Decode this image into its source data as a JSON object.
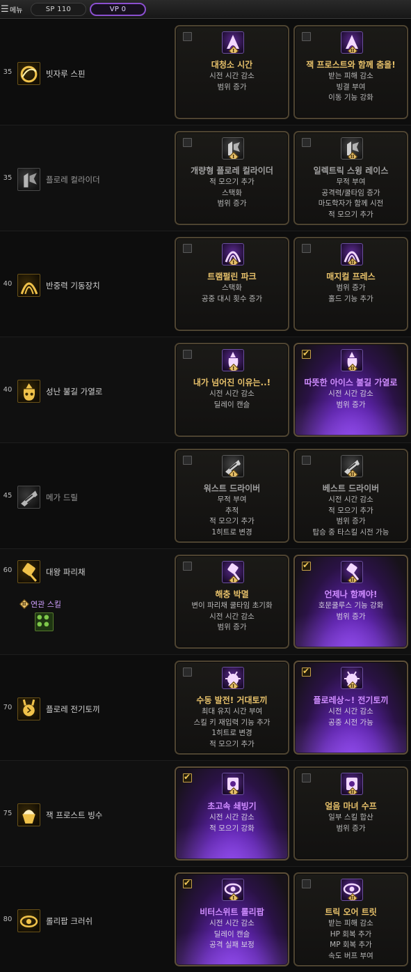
{
  "topbar": {
    "menu_icon": "hamburger-icon",
    "menu_label": "메뉴",
    "sp": "SP 110",
    "vp": "VP 0"
  },
  "rows": [
    {
      "level": "35",
      "name": "빗자루 스핀",
      "icon": "broom-spin-icon",
      "grey": false,
      "options": [
        {
          "checked": false,
          "roman": "I",
          "title": "대청소 시간",
          "title_color": "gold",
          "icon": "witch-hat-icon",
          "lines": [
            "시전 시간 감소",
            "범위 증가"
          ]
        },
        {
          "checked": false,
          "roman": "II",
          "title": "잭 프로스트와 함께 춤을!",
          "title_color": "gold",
          "icon": "witch-hat-icon",
          "lines": [
            "받는 피해 감소",
            "빙결 부여",
            "이동 기능 강화"
          ]
        }
      ]
    },
    {
      "level": "35",
      "name": "플로레 컬라이더",
      "icon": "flore-collider-icon",
      "grey": true,
      "options": [
        {
          "checked": false,
          "roman": "I",
          "title": "개량형 플로레 컬라이더",
          "title_color": "grey",
          "icon": "collider-icon",
          "lines": [
            "적 모으기 추가",
            "스택화",
            "범위 증가"
          ]
        },
        {
          "checked": false,
          "roman": "II",
          "title": "일렉트릭 스윙 레이스",
          "title_color": "grey",
          "icon": "collider-icon",
          "lines": [
            "무적 부여",
            "공격력/쿨타임 증가",
            "마도학자가 함께 시전",
            "적 모으기 추가"
          ]
        }
      ]
    },
    {
      "level": "40",
      "name": "반중력 기동장치",
      "icon": "antigravity-icon",
      "grey": false,
      "options": [
        {
          "checked": false,
          "roman": "I",
          "title": "트램펄린 파크",
          "title_color": "gold",
          "icon": "arch-icon",
          "lines": [
            "스택화",
            "공중 대시 횟수 증가"
          ]
        },
        {
          "checked": false,
          "roman": "II",
          "title": "매지컬 프레스",
          "title_color": "gold",
          "icon": "arch-icon",
          "lines": [
            "범위 증가",
            "홀드 기능 추가"
          ]
        }
      ]
    },
    {
      "level": "40",
      "name": "성난 불길 가열로",
      "icon": "furnace-bag-icon",
      "grey": false,
      "options": [
        {
          "checked": false,
          "roman": "I",
          "title": "내가 넘어진 이유는..!",
          "title_color": "gold",
          "icon": "flame-bag-icon",
          "lines": [
            "시전 시간 감소",
            "딜레이 캔슬"
          ]
        },
        {
          "checked": true,
          "roman": "II",
          "title": "따뜻한 아이스 불길 가열로",
          "title_color": "purple",
          "icon": "flame-bag-icon",
          "lines": [
            "시전 시간 감소",
            "범위 증가"
          ]
        }
      ]
    },
    {
      "level": "45",
      "name": "메가 드릴",
      "icon": "mega-drill-icon",
      "grey": true,
      "options": [
        {
          "checked": false,
          "roman": "I",
          "title": "워스트 드라이버",
          "title_color": "grey",
          "icon": "drill-icon",
          "lines": [
            "무적 부여",
            "추적",
            "적 모으기 추가",
            "1히트로 변경"
          ]
        },
        {
          "checked": false,
          "roman": "II",
          "title": "베스트 드라이버",
          "title_color": "grey",
          "icon": "drill-icon",
          "lines": [
            "시전 시간 감소",
            "적 모으기 추가",
            "범위 증가",
            "탑승 중 타스킬 시전 가능"
          ]
        }
      ]
    },
    {
      "level": "60",
      "name": "대왕 파리채",
      "icon": "fly-swatter-icon",
      "grey": false,
      "related": {
        "roman": "II",
        "label": "연관 스킬",
        "icon": "related-skill-icon"
      },
      "options": [
        {
          "checked": false,
          "roman": "I",
          "title": "해충 박멸",
          "title_color": "gold",
          "icon": "swatter-icon",
          "lines": [
            "변이 파리채 쿨타임 초기화",
            "시전 시간 감소",
            "범위 증가"
          ]
        },
        {
          "checked": true,
          "roman": "II",
          "title": "언제나 함께야!",
          "title_color": "purple",
          "icon": "swatter-icon",
          "lines": [
            "호문쿨루스 기능 강화",
            "범위 증가"
          ]
        }
      ]
    },
    {
      "level": "70",
      "name": "플로레 전기토끼",
      "icon": "electric-rabbit-icon",
      "grey": false,
      "options": [
        {
          "checked": false,
          "roman": "I",
          "title": "수동 발전! 거대토끼",
          "title_color": "gold",
          "icon": "rabbit-icon",
          "lines": [
            "최대 유지 시간 부여",
            "스킬 키 재입력 기능 추가",
            "1히트로 변경",
            "적 모으기 추가"
          ]
        },
        {
          "checked": true,
          "roman": "II",
          "title": "플로레상~! 전기토끼",
          "title_color": "purple",
          "icon": "rabbit-icon",
          "lines": [
            "시전 시간 감소",
            "공중 시전 가능"
          ]
        }
      ]
    },
    {
      "level": "75",
      "name": "잭 프로스트 빙수",
      "icon": "shaved-ice-icon",
      "grey": false,
      "options": [
        {
          "checked": true,
          "roman": "I",
          "title": "초고속 쇄빙기",
          "title_color": "purple",
          "icon": "ice-machine-icon",
          "lines": [
            "시전 시간 감소",
            "적 모으기 강화"
          ]
        },
        {
          "checked": false,
          "roman": "II",
          "title": "얼음 마녀 수프",
          "title_color": "gold",
          "icon": "ice-machine-icon",
          "lines": [
            "일부 스킬 합산",
            "범위 증가"
          ]
        }
      ]
    },
    {
      "level": "80",
      "name": "롤리팝 크러쉬",
      "icon": "lollipop-icon",
      "grey": false,
      "options": [
        {
          "checked": true,
          "roman": "I",
          "title": "비터스위트 롤리팝",
          "title_color": "purple",
          "icon": "eye-lollipop-icon",
          "lines": [
            "시전 시간 감소",
            "딜레이 캔슬",
            "공격 실패 보정"
          ]
        },
        {
          "checked": false,
          "roman": "II",
          "title": "트릭 오어 트릿",
          "title_color": "gold",
          "icon": "eye-lollipop-icon",
          "lines": [
            "받는 피해 감소",
            "HP 회복 추가",
            "MP 회복 추가",
            "속도 버프 부여"
          ]
        }
      ]
    }
  ]
}
